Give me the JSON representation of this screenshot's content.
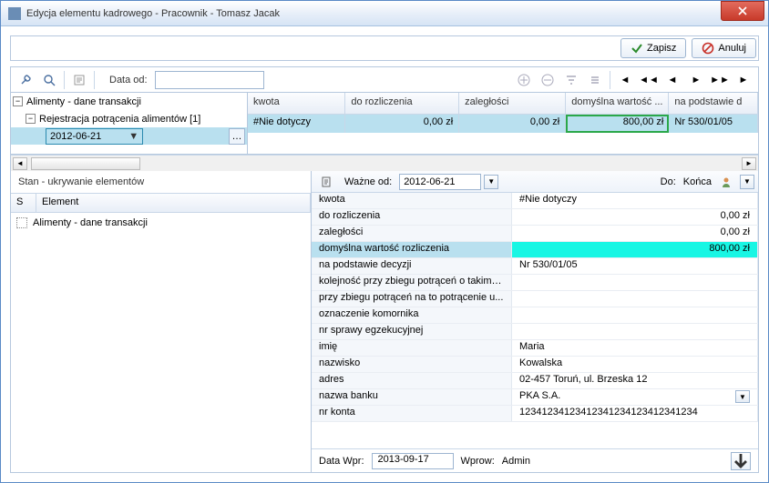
{
  "window": {
    "title": "Edycja elementu kadrowego - Pracownik - Tomasz Jacak"
  },
  "buttons": {
    "save": "Zapisz",
    "cancel": "Anuluj"
  },
  "toolbar": {
    "date_from_label": "Data od:",
    "date_from_value": ""
  },
  "tree": {
    "root": "Alimenty - dane transakcji",
    "child": "Rejestracja potrącenia alimentów [1]",
    "date": "2012-06-21"
  },
  "grid": {
    "headers": [
      "kwota",
      "do rozliczenia",
      "zaległości",
      "domyślna wartość ...",
      "na podstawie d"
    ],
    "row": [
      "#Nie dotyczy",
      "0,00 zł",
      "0,00 zł",
      "800,00 zł",
      "Nr 530/01/05"
    ]
  },
  "state": {
    "title": "Stan - ukrywanie elementów",
    "cols": [
      "S",
      "Element"
    ],
    "item": "Alimenty - dane transakcji"
  },
  "detail_bar": {
    "valid_from_label": "Ważne od:",
    "valid_from": "2012-06-21",
    "to_label": "Do:",
    "to_value": "Końca"
  },
  "details": [
    {
      "label": "kwota",
      "value": "#Nie dotyczy",
      "align": "l"
    },
    {
      "label": "do rozliczenia",
      "value": "0,00 zł",
      "align": "r"
    },
    {
      "label": "zaległości",
      "value": "0,00 zł",
      "align": "r"
    },
    {
      "label": "domyślna wartość rozliczenia",
      "value": "800,00 zł",
      "align": "r",
      "hl": true
    },
    {
      "label": "na podstawie decyzji",
      "value": "Nr 530/01/05",
      "align": "l"
    },
    {
      "label": "kolejność przy zbiegu potrąceń o takim s...",
      "value": "",
      "align": "l"
    },
    {
      "label": "przy zbiegu potrąceń na to potrącenie u...",
      "value": "",
      "align": "l"
    },
    {
      "label": "oznaczenie komornika",
      "value": "",
      "align": "l"
    },
    {
      "label": "nr sprawy egzekucyjnej",
      "value": "",
      "align": "l"
    },
    {
      "label": "imię",
      "value": "Maria",
      "align": "l"
    },
    {
      "label": "nazwisko",
      "value": "Kowalska",
      "align": "l"
    },
    {
      "label": "adres",
      "value": "02-457 Toruń, ul. Brzeska 12",
      "align": "l"
    },
    {
      "label": "nazwa banku",
      "value": "PKA S.A.",
      "align": "l",
      "dd": true
    },
    {
      "label": "nr konta",
      "value": "12341234123412341234123412341234",
      "align": "l"
    }
  ],
  "footer": {
    "entry_date_label": "Data Wpr:",
    "entry_date": "2013-09-17",
    "entered_by_label": "Wprow:",
    "entered_by": "Admin"
  }
}
